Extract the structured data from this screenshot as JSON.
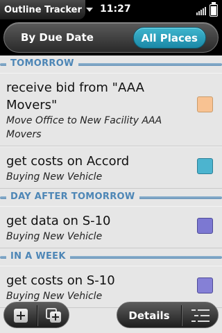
{
  "status_bar": {
    "app_title": "Outline Tracker",
    "time": "11:27"
  },
  "header": {
    "sort_label": "By Due Date",
    "place_filter_label": "All Places"
  },
  "sections": [
    {
      "title": "TOMORROW",
      "items": [
        {
          "title": "receive bid from \"AAA Movers\"",
          "subtitle": "Move Office to New Facility AAA Movers",
          "color": "#f8c292"
        }
      ]
    },
    {
      "title": "",
      "items": [
        {
          "title": "get costs on Accord",
          "subtitle": "Buying New Vehicle",
          "color": "#4cb4cf"
        }
      ]
    },
    {
      "title": "DAY AFTER TOMORROW",
      "items": [
        {
          "title": "get data on S-10",
          "subtitle": "Buying New Vehicle",
          "color": "#7c78d2"
        }
      ]
    },
    {
      "title": "IN A WEEK",
      "items": [
        {
          "title": "get costs on S-10",
          "subtitle": "Buying New Vehicle",
          "color": "#8580d6"
        }
      ]
    }
  ],
  "command_menu": {
    "details_label": "Details",
    "add_icon": "add-icon",
    "add_subitem_icon": "add-subitem-icon",
    "outline_icon": "outline-view-icon"
  },
  "colors": {
    "accent": "#2aa6c2",
    "section_label": "#4d86b6"
  }
}
